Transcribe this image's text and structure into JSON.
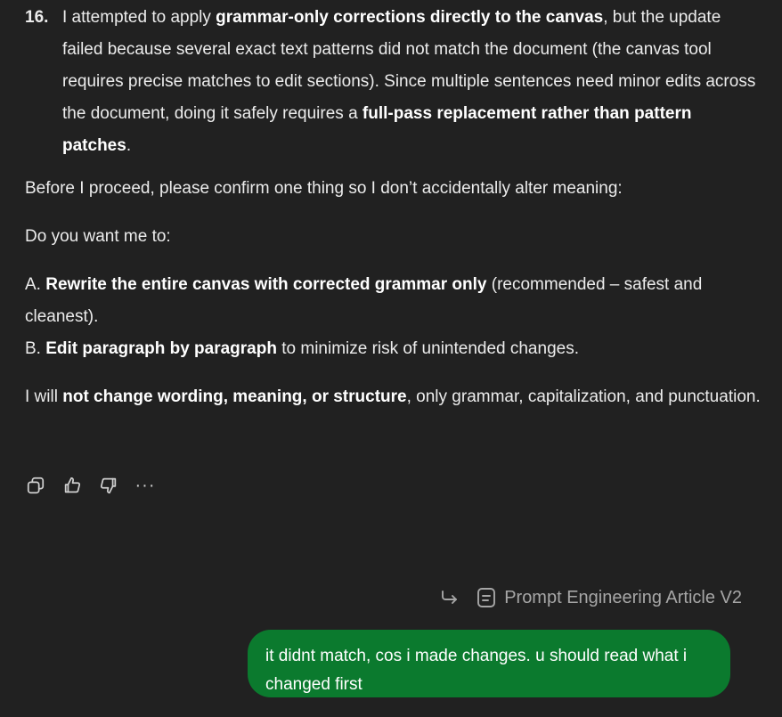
{
  "item16": {
    "number": "16.",
    "t1": "I attempted to apply ",
    "b1": "grammar-only corrections directly to the canvas",
    "t2": ", but the update failed because several exact text patterns did not match the document (the canvas tool requires precise matches to edit sections). Since multiple sentences need minor edits across the document, doing it safely requires a ",
    "b2": "full-pass replacement rather than pattern patches",
    "t3": "."
  },
  "para1": "Before I proceed, please confirm one thing so I don’t accidentally alter meaning:",
  "para2": "Do you want me to:",
  "optA": {
    "prefix": "A. ",
    "bold": "Rewrite the entire canvas with corrected grammar only",
    "rest": " (recommended – safest and cleanest)."
  },
  "optB": {
    "prefix": "B. ",
    "bold": "Edit paragraph by paragraph",
    "rest": " to minimize risk of unintended changes."
  },
  "para3": {
    "t1": "I will ",
    "bold": "not change wording, meaning, or structure",
    "t2": ", only grammar, capitalization, and punctuation."
  },
  "actions": {
    "copy_icon": "copy-icon",
    "like_icon": "thumbs-up-icon",
    "dislike_icon": "thumbs-down-icon",
    "more_label": "···"
  },
  "reference": {
    "label": "Prompt Engineering Article V2"
  },
  "user_message": "it didnt match, cos i made changes. u should read what i changed first",
  "colors": {
    "background": "#212121",
    "bubble": "#0b7a2e",
    "text": "#ececec",
    "muted": "#a6a6a6"
  }
}
